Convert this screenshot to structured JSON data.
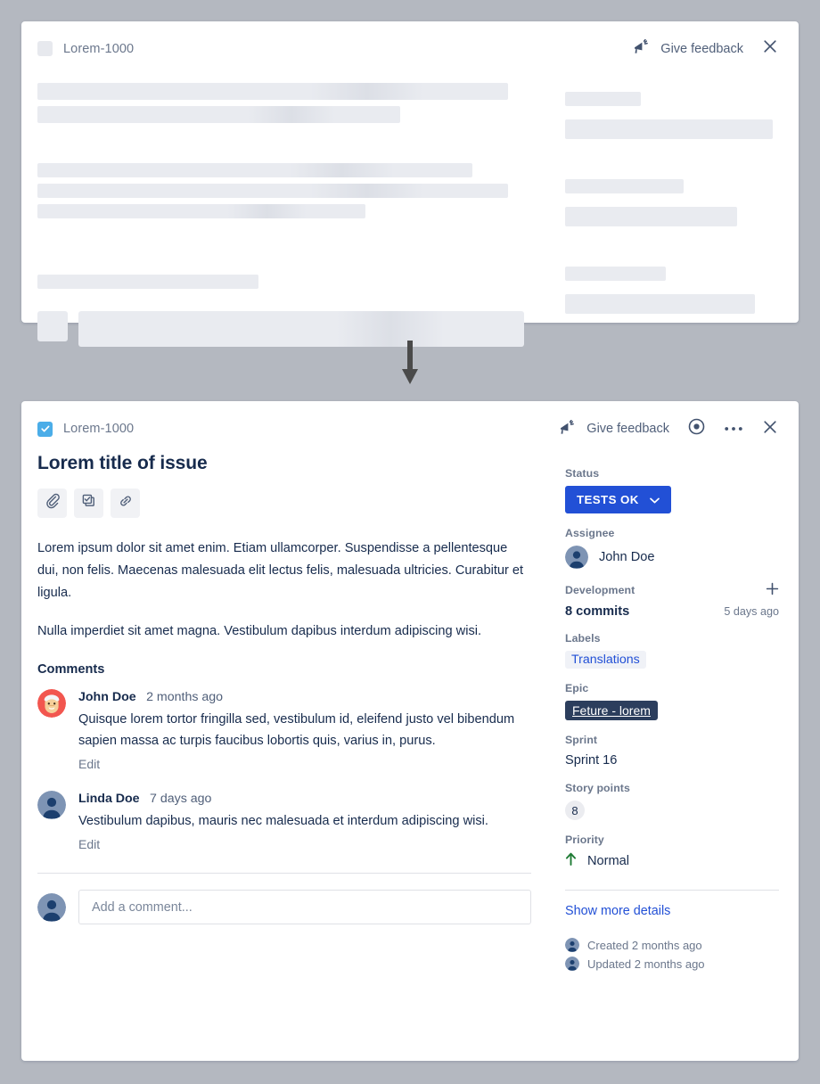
{
  "background_color": "#b4b8c0",
  "accent_color": "#2250d6",
  "loading_card": {
    "issue_key": "Lorem-1000",
    "feedback_label": "Give feedback",
    "icons": {
      "megaphone": "megaphone-icon",
      "close": "close-icon"
    }
  },
  "transition": {
    "arrow": "arrow-down-icon"
  },
  "loaded_card": {
    "issue_key": "Lorem-1000",
    "feedback_label": "Give feedback",
    "icons": {
      "megaphone": "megaphone-icon",
      "watch": "eye-icon",
      "more": "more-actions-icon",
      "close": "close-icon"
    },
    "title": "Lorem title of issue",
    "actions": [
      {
        "name": "attach-button",
        "icon": "paperclip-icon"
      },
      {
        "name": "add-child-issue-button",
        "icon": "child-issue-icon"
      },
      {
        "name": "link-issue-button",
        "icon": "link-icon"
      }
    ],
    "description": [
      "Lorem ipsum dolor sit amet enim. Etiam ullamcorper. Suspendisse a pellentesque dui, non felis. Maecenas malesuada elit lectus felis, malesuada ultricies. Curabitur et ligula.",
      "Nulla imperdiet sit amet magna. Vestibulum dapibus interdum adipiscing wisi."
    ],
    "comments_heading": "Comments",
    "comments": [
      {
        "author": "John Doe",
        "time": "2 months ago",
        "text": "Quisque lorem tortor fringilla sed, vestibulum id, eleifend justo vel bibendum sapien massa ac turpis faucibus lobortis quis, varius in, purus.",
        "edit_label": "Edit",
        "avatar": "santa-emoji-avatar"
      },
      {
        "author": "Linda Doe",
        "time": "7 days ago",
        "text": "Vestibulum dapibus, mauris nec malesuada et interdum adipiscing wisi.",
        "edit_label": "Edit",
        "avatar": "default-person-avatar"
      }
    ],
    "add_comment": {
      "placeholder": "Add a comment...",
      "value": "",
      "avatar": "default-person-avatar"
    },
    "sidebar": {
      "status": {
        "label": "Status",
        "value": "TESTS OK",
        "chevron": "chevron-down-icon"
      },
      "assignee": {
        "label": "Assignee",
        "value": "John Doe",
        "avatar": "default-person-avatar"
      },
      "development": {
        "label": "Development",
        "add_icon": "plus-icon",
        "value": "8 commits",
        "time": "5 days ago"
      },
      "labels": {
        "label": "Labels",
        "chips": [
          "Translations"
        ]
      },
      "epic": {
        "label": "Epic",
        "value": "Feture - lorem"
      },
      "sprint": {
        "label": "Sprint",
        "value": "Sprint 16"
      },
      "story_points": {
        "label": "Story points",
        "value": "8"
      },
      "priority": {
        "label": "Priority",
        "value": "Normal",
        "icon": "arrow-up-icon",
        "icon_color": "#1e7b34"
      },
      "show_more_label": "Show more details",
      "timestamps": [
        {
          "text": "Created 2 months ago"
        },
        {
          "text": "Updated 2 months ago"
        }
      ]
    }
  }
}
